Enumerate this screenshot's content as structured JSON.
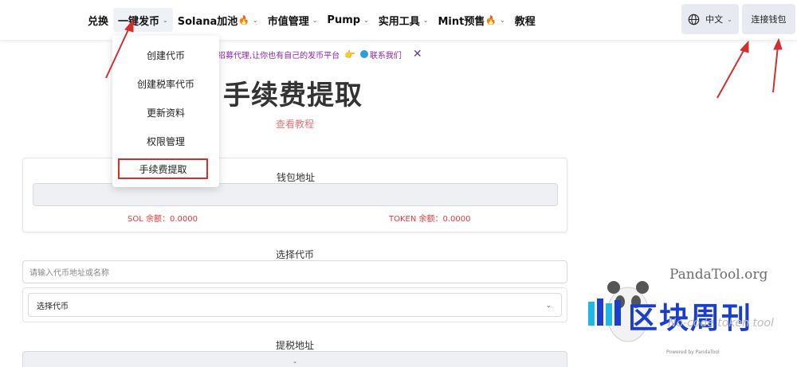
{
  "nav": {
    "items": [
      {
        "label": "兑换",
        "chevron": false
      },
      {
        "label": "一键发币",
        "chevron": true
      },
      {
        "label": "Solana加池",
        "chevron": true,
        "fire": "🔥"
      },
      {
        "label": "市值管理",
        "chevron": true
      },
      {
        "label": "Pump",
        "chevron": true
      },
      {
        "label": "实用工具",
        "chevron": true
      },
      {
        "label": "Mint预售",
        "chevron": true,
        "fire": "🔥"
      },
      {
        "label": "教程",
        "chevron": false
      }
    ],
    "active_index": 1
  },
  "header": {
    "language_label": "中文",
    "connect_wallet_label": "连接钱包"
  },
  "dropdown": {
    "items": [
      "创建代币",
      "创建税率代币",
      "更新资料",
      "权限管理",
      "手续费提取"
    ],
    "highlighted_index": 4
  },
  "banner": {
    "text": "J招募代理,让你也有自己的发币平台",
    "hand": "👉",
    "contact_label": "联系我们",
    "close": "✕"
  },
  "page": {
    "title": "手续费提取",
    "tutorial_link": "查看教程"
  },
  "wallet": {
    "title": "钱包地址",
    "address_value": "",
    "sol_balance": "SOL 余额：0.0000",
    "token_balance": "TOKEN 余额：0.0000"
  },
  "token_select": {
    "label": "选择代币",
    "input_placeholder": "请输入代币地址或名称",
    "select_value": "选择代币"
  },
  "tax_address": {
    "label": "提税地址",
    "value": "-"
  },
  "watermark": {
    "site": "PandaTool.org",
    "subtitle": "No-code token tool",
    "cn_title": "区块周刊",
    "powered": "Powered by PandaTool"
  },
  "colors": {
    "accent_red": "#d32f2f",
    "balance_red": "#e53935",
    "banner_purple": "#8e24aa",
    "button_bg": "#e7eaf0",
    "watermark_blue": "#1a3fd0"
  },
  "icons": [
    "globe-icon",
    "chevron-down-icon",
    "fire-icon",
    "telegram-icon",
    "close-icon",
    "arrow-annotation"
  ]
}
